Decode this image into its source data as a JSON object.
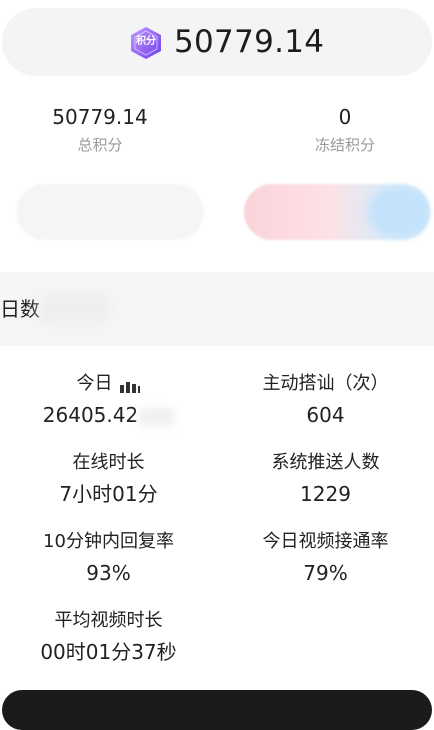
{
  "header": {
    "badge_text": "积分",
    "total_points": "50779.14"
  },
  "summary": {
    "total": {
      "value": "50779.14",
      "label": "总积分"
    },
    "frozen": {
      "value": "0",
      "label": "冻结积分"
    }
  },
  "section": {
    "title": "日数"
  },
  "metrics": [
    {
      "label": "今日",
      "value": "26405.42",
      "icon": "data-icon"
    },
    {
      "label": "主动搭讪（次）",
      "value": "604"
    },
    {
      "label": "在线时长",
      "value": "7小时01分"
    },
    {
      "label": "系统推送人数",
      "value": "1229"
    },
    {
      "label": "10分钟内回复率",
      "value": "93%"
    },
    {
      "label": "今日视频接通率",
      "value": "79%"
    },
    {
      "label": "平均视频时长",
      "value": "00时01分37秒"
    }
  ],
  "colors": {
    "badge_start": "#b18bff",
    "badge_end": "#7a46f0",
    "label_gray": "#9a9a9a",
    "header_bg": "#f4f4f6",
    "section_bg": "#f6f6f8",
    "pink": "#fbd3da",
    "blue": "#cde6fb"
  }
}
